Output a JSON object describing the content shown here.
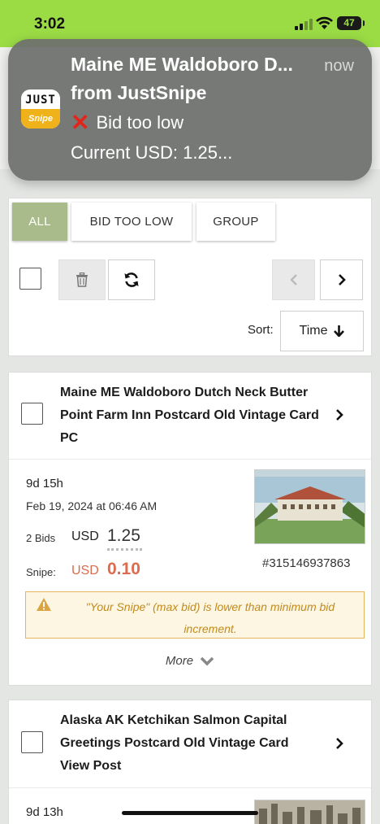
{
  "status": {
    "time": "3:02",
    "battery": "47"
  },
  "notification": {
    "app_icon_top": "JUST",
    "app_icon_bottom": "Snipe",
    "title": "Maine ME Waldoboro D...",
    "subtitle": "from JustSnipe",
    "time": "now",
    "status_text": "Bid too low",
    "detail": "Current USD: 1.25..."
  },
  "filters": {
    "tabs": [
      "ALL",
      "BID TOO LOW",
      "GROUP"
    ],
    "active_tab": "ALL",
    "sort_label": "Sort:",
    "sort_value": "Time"
  },
  "listings": [
    {
      "title": "Maine ME Waldoboro Dutch Neck Butter Point Farm Inn Postcard Old Vintage Card PC",
      "time_left": "9d 15h",
      "end_date": "Feb 19, 2024 at 06:46 AM",
      "bids": "2 Bids",
      "currency": "USD",
      "current_price": "1.25",
      "snipe_label": "Snipe:",
      "snipe_currency": "USD",
      "snipe_amount": "0.10",
      "item_id": "#315146937863",
      "warning": "\"Your Snipe\" (max bid) is lower than minimum bid increment.",
      "more_label": "More"
    },
    {
      "title": "Alaska AK Ketchikan Salmon Capital Greetings Postcard Old Vintage Card View Post",
      "time_left": "9d 13h"
    }
  ],
  "colors": {
    "accent_green": "#9bdc45",
    "active_tab": "#a9bb8b",
    "snipe_red": "#dd6b4d",
    "warning_text": "#c08b1d"
  }
}
